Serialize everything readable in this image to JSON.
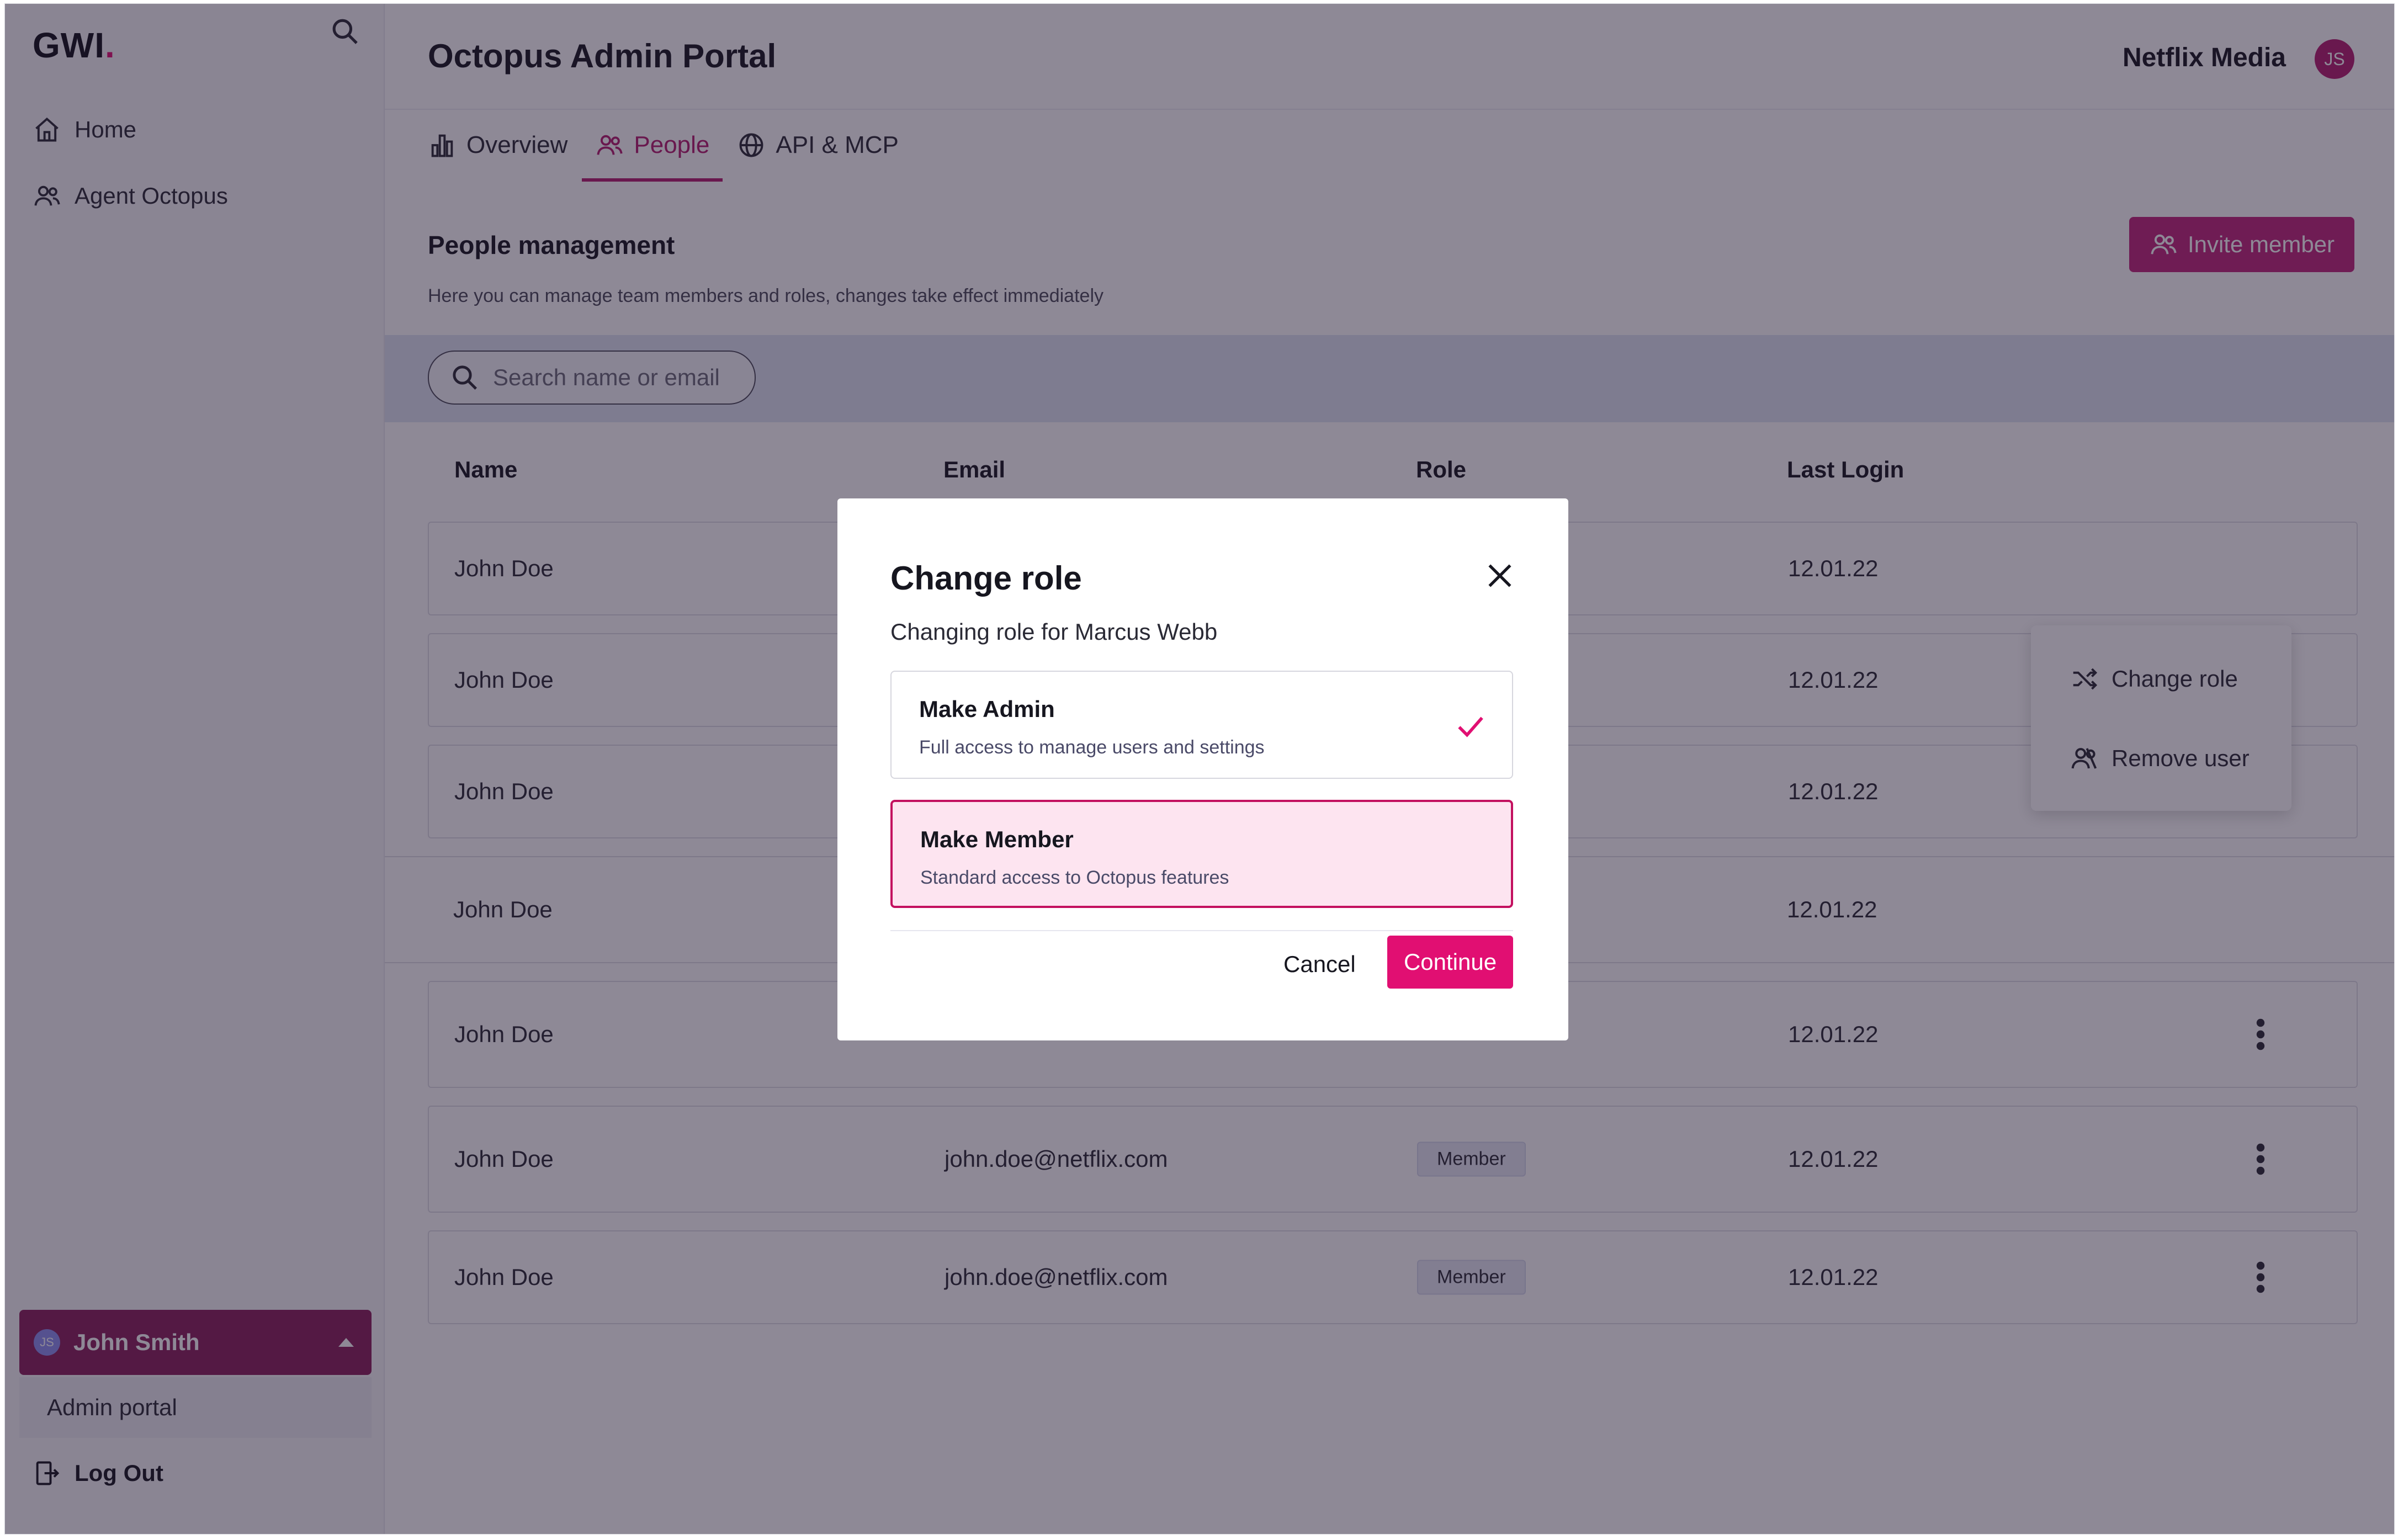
{
  "sidebar": {
    "logo": "GWI",
    "logo_dot": ".",
    "nav": [
      {
        "label": "Home",
        "icon": "home-icon"
      },
      {
        "label": "Agent Octopus",
        "icon": "users-icon"
      }
    ],
    "user": {
      "initials": "JS",
      "name": "John Smith"
    },
    "submenu_item": "Admin portal",
    "logout": "Log Out"
  },
  "header": {
    "title": "Octopus Admin Portal",
    "org_name": "Netflix Media",
    "org_initials": "JS"
  },
  "tabs": [
    {
      "label": "Overview",
      "icon": "bar-chart-icon",
      "active": false
    },
    {
      "label": "People",
      "icon": "users-icon",
      "active": true
    },
    {
      "label": "API & MCP",
      "icon": "globe-icon",
      "active": false
    }
  ],
  "section": {
    "title": "People management",
    "subtitle": "Here you can manage team members and roles, changes take effect immediately",
    "invite_label": "Invite member"
  },
  "search": {
    "placeholder": "Search name or email"
  },
  "table": {
    "headers": [
      "Name",
      "Email",
      "Role",
      "Last Login"
    ],
    "rows": [
      {
        "name": "John Doe",
        "email": "",
        "role": "",
        "last_login": "12.01.22"
      },
      {
        "name": "John Doe",
        "email": "",
        "role": "",
        "last_login": "12.01.22"
      },
      {
        "name": "John Doe",
        "email": "",
        "role": "",
        "last_login": "12.01.22"
      },
      {
        "name": "John Doe",
        "email": "",
        "role": "",
        "last_login": "12.01.22"
      },
      {
        "name": "John Doe",
        "email": "",
        "role": "",
        "last_login": "12.01.22"
      },
      {
        "name": "John Doe",
        "email": "john.doe@netflix.com",
        "role": "Member",
        "last_login": "12.01.22"
      },
      {
        "name": "John Doe",
        "email": "john.doe@netflix.com",
        "role": "Member",
        "last_login": "12.01.22"
      }
    ]
  },
  "context_menu": {
    "items": [
      {
        "label": "Change role",
        "icon": "shuffle-icon"
      },
      {
        "label": "Remove user",
        "icon": "remove-user-icon"
      }
    ]
  },
  "modal": {
    "title": "Change role",
    "subtitle": "Changing role for Marcus Webb",
    "options": [
      {
        "title": "Make Admin",
        "description": "Full access to manage users and settings",
        "checked": true
      },
      {
        "title": "Make Member",
        "description": "Standard access to Octopus features",
        "selected": true
      }
    ],
    "cancel_label": "Cancel",
    "continue_label": "Continue"
  },
  "colors": {
    "brand": "#e10f72",
    "brand_dark": "#8a1e5a",
    "accent": "#b51d6e",
    "selected_bg": "#fde4f0"
  }
}
